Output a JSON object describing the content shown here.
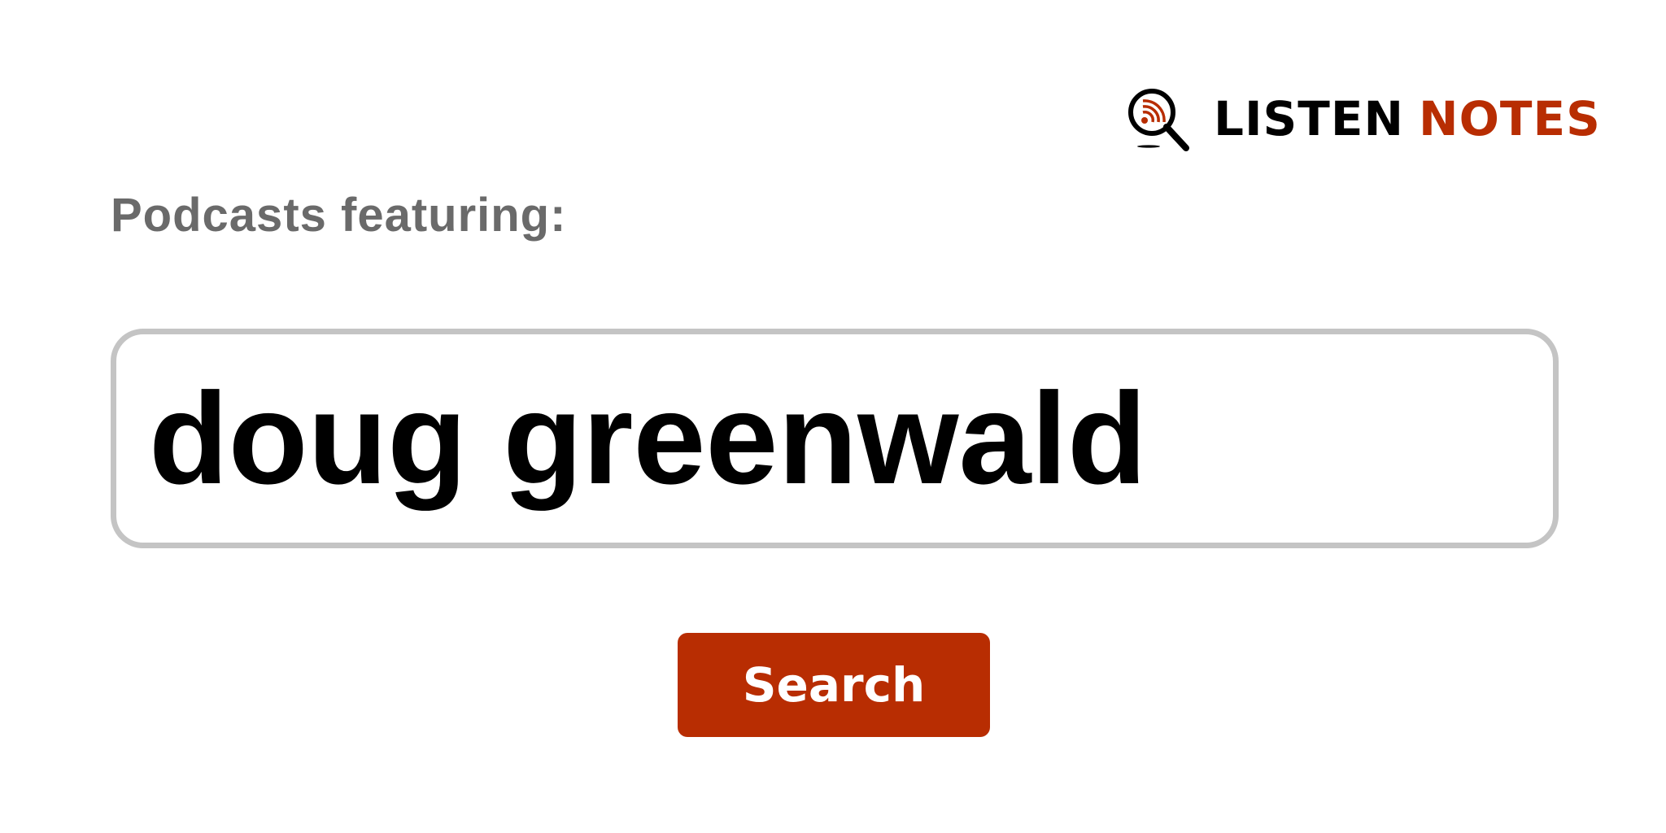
{
  "brand": {
    "listen": "LISTEN",
    "notes": "NOTES",
    "icon": "magnifier-podcast-icon",
    "colors": {
      "accent": "#b82d02",
      "dark": "#000000"
    }
  },
  "page": {
    "title": "Podcasts featuring:"
  },
  "search": {
    "value": "doug greenwald",
    "button_label": "Search"
  },
  "colors": {
    "title_gray": "#6a6a6a",
    "input_border": "#c4c4c4",
    "button_bg": "#b82d02",
    "button_text": "#ffffff"
  }
}
